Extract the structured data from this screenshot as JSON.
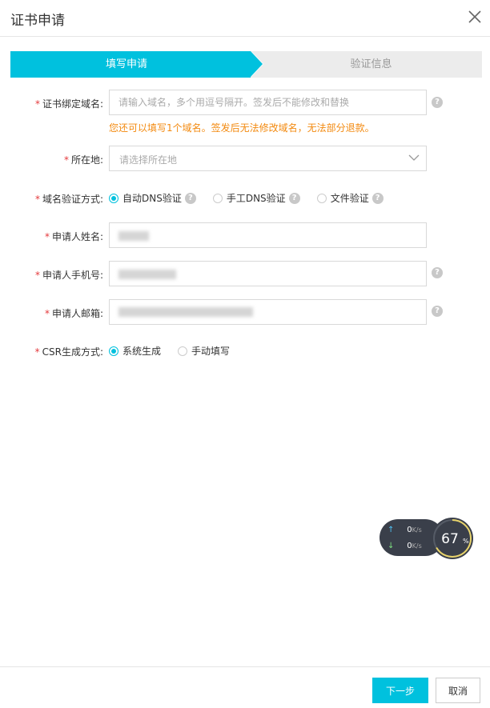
{
  "dialog": {
    "title": "证书申请"
  },
  "steps": {
    "active": "填写申请",
    "next": "验证信息"
  },
  "form": {
    "domain": {
      "label": "证书绑定域名:",
      "placeholder": "请输入域名，多个用逗号隔开。签发后不能修改和替换",
      "hint": "您还可以填写1个域名。签发后无法修改域名，无法部分退款。"
    },
    "location": {
      "label": "所在地:",
      "placeholder": "请选择所在地"
    },
    "verify_method": {
      "label": "域名验证方式:",
      "options": [
        "自动DNS验证",
        "手工DNS验证",
        "文件验证"
      ],
      "selected": "自动DNS验证"
    },
    "applicant_name": {
      "label": "申请人姓名:"
    },
    "applicant_phone": {
      "label": "申请人手机号:"
    },
    "applicant_email": {
      "label": "申请人邮箱:"
    },
    "csr_method": {
      "label": "CSR生成方式:",
      "options": [
        "系统生成",
        "手动填写"
      ],
      "selected": "系统生成"
    },
    "required_mark": "*",
    "help_glyph": "?"
  },
  "footer": {
    "next_label": "下一步",
    "cancel_label": "取消"
  },
  "net_monitor": {
    "up": "0",
    "down": "0",
    "unit": "K/s",
    "percent": "67",
    "percent_sign": "%"
  },
  "colors": {
    "accent": "#00c1de",
    "hint": "#f38a10",
    "required": "#e4393c"
  }
}
